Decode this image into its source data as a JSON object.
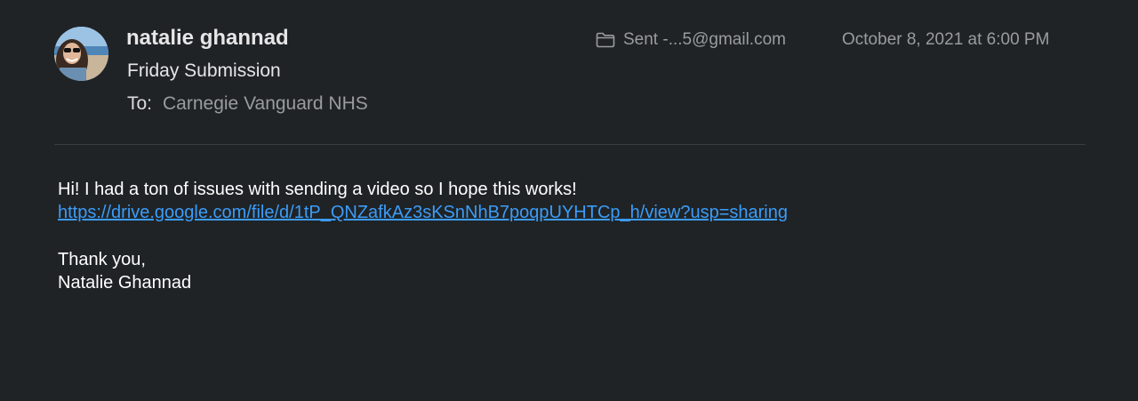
{
  "header": {
    "sender_name": "natalie ghannad",
    "subject": "Friday Submission",
    "to_label": "To:",
    "to_value": "Carnegie Vanguard NHS",
    "mailbox": "Sent -...5@gmail.com",
    "mailbox_icon": "folder-icon",
    "date": "October 8, 2021 at 6:00 PM"
  },
  "message": {
    "line1": "Hi! I had a ton of issues with sending a video so I hope this works!",
    "link": "https://drive.google.com/file/d/1tP_QNZafkAz3sKSnNhB7poqpUYHTCp_h/view?usp=sharing",
    "closing": "Thank you,",
    "signature": "Natalie Ghannad"
  },
  "colors": {
    "background": "#1f2326",
    "link": "#3c9cf8",
    "secondary_text": "#9a9c9e"
  }
}
